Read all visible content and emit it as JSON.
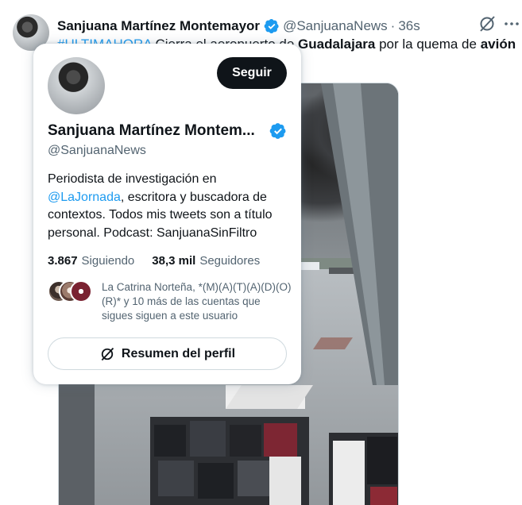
{
  "tweet": {
    "author_name": "Sanjuana Martínez Montemayor",
    "handle": "@SanjuanaNews",
    "separator": "·",
    "time": "36s",
    "text_hashtag": "#ULTIMAHORA",
    "text_fragment": "Cierra el aeropuerto de",
    "text_bold_1": "Guadalajara",
    "text_middle": "por la quema de",
    "text_bold_2": "avión"
  },
  "hover_card": {
    "name": "Sanjuana Martínez Montem...",
    "handle": "@SanjuanaNews",
    "follow_label": "Seguir",
    "bio_part1": "Periodista de investigación en",
    "bio_mention": "@LaJornada",
    "bio_part2": ", escritora y buscadora de contextos. Todos mis tweets son a título personal. Podcast: SanjuanaSinFiltro",
    "following_count": "3.867",
    "following_label": "Siguiendo",
    "followers_count": "38,3 mil",
    "followers_label": "Seguidores",
    "followed_by_text": "La Catrina Norteña, *(M)(A)(T)(A)(D)(O)(R)* y 10 más de las cuentas que sigues siguen a este usuario",
    "summary_label": "Resumen del perfil"
  },
  "colors": {
    "accent": "#1d9bf0",
    "text": "#0f1419",
    "muted": "#536471",
    "follow_button": "#0f1419"
  },
  "icons": [
    "verified-badge-icon",
    "grok-icon",
    "more-icon",
    "summary-icon"
  ]
}
